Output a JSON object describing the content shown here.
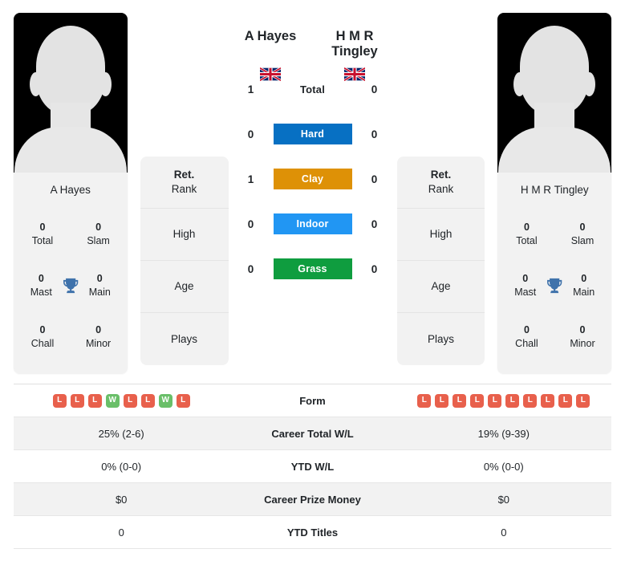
{
  "players": {
    "left": {
      "name": "A Hayes",
      "card_name": "A Hayes",
      "flag": "uk-flag-icon",
      "titles": [
        {
          "value": "0",
          "label": "Total"
        },
        {
          "value": "0",
          "label": "Slam"
        },
        {
          "value": "0",
          "label": "Mast"
        },
        {
          "value": "0",
          "label": "Main"
        },
        {
          "value": "0",
          "label": "Chall"
        },
        {
          "value": "0",
          "label": "Minor"
        }
      ],
      "info": [
        {
          "top": "Ret.",
          "bottom": "Rank"
        },
        {
          "top": "",
          "bottom": "High"
        },
        {
          "top": "",
          "bottom": "Age"
        },
        {
          "top": "",
          "bottom": "Plays"
        }
      ],
      "form": [
        "L",
        "L",
        "L",
        "W",
        "L",
        "L",
        "W",
        "L"
      ],
      "career_total_wl": "25% (2-6)",
      "ytd_wl": "0% (0-0)",
      "career_prize_money": "$0",
      "ytd_titles": "0"
    },
    "right": {
      "name": "H M R Tingley",
      "card_name": "H M R Tingley",
      "flag": "uk-flag-icon",
      "titles": [
        {
          "value": "0",
          "label": "Total"
        },
        {
          "value": "0",
          "label": "Slam"
        },
        {
          "value": "0",
          "label": "Mast"
        },
        {
          "value": "0",
          "label": "Main"
        },
        {
          "value": "0",
          "label": "Chall"
        },
        {
          "value": "0",
          "label": "Minor"
        }
      ],
      "info": [
        {
          "top": "Ret.",
          "bottom": "Rank"
        },
        {
          "top": "",
          "bottom": "High"
        },
        {
          "top": "",
          "bottom": "Age"
        },
        {
          "top": "",
          "bottom": "Plays"
        }
      ],
      "form": [
        "L",
        "L",
        "L",
        "L",
        "L",
        "L",
        "L",
        "L",
        "L",
        "L"
      ],
      "career_total_wl": "19% (9-39)",
      "ytd_wl": "0% (0-0)",
      "career_prize_money": "$0",
      "ytd_titles": "0"
    }
  },
  "h2h": {
    "rows": [
      {
        "label": "Total",
        "left": "1",
        "right": "0",
        "color": ""
      },
      {
        "label": "Hard",
        "left": "0",
        "right": "0",
        "color": "#0770c3"
      },
      {
        "label": "Clay",
        "left": "1",
        "right": "0",
        "color": "#de9106"
      },
      {
        "label": "Indoor",
        "left": "0",
        "right": "0",
        "color": "#2196f3"
      },
      {
        "label": "Grass",
        "left": "0",
        "right": "0",
        "color": "#0f9d3f"
      }
    ]
  },
  "table": {
    "rows": [
      {
        "label": "Form",
        "type": "form"
      },
      {
        "label": "Career Total W/L",
        "type": "text",
        "key": "career_total_wl"
      },
      {
        "label": "YTD W/L",
        "type": "text",
        "key": "ytd_wl"
      },
      {
        "label": "Career Prize Money",
        "type": "text",
        "key": "career_prize_money"
      },
      {
        "label": "YTD Titles",
        "type": "text",
        "key": "ytd_titles"
      }
    ]
  },
  "colors": {
    "win": "#6abf69",
    "loss": "#e8604c",
    "trophy": "#3f72ab",
    "card_bg": "#f2f2f2",
    "alt_row": "#f2f2f2"
  }
}
